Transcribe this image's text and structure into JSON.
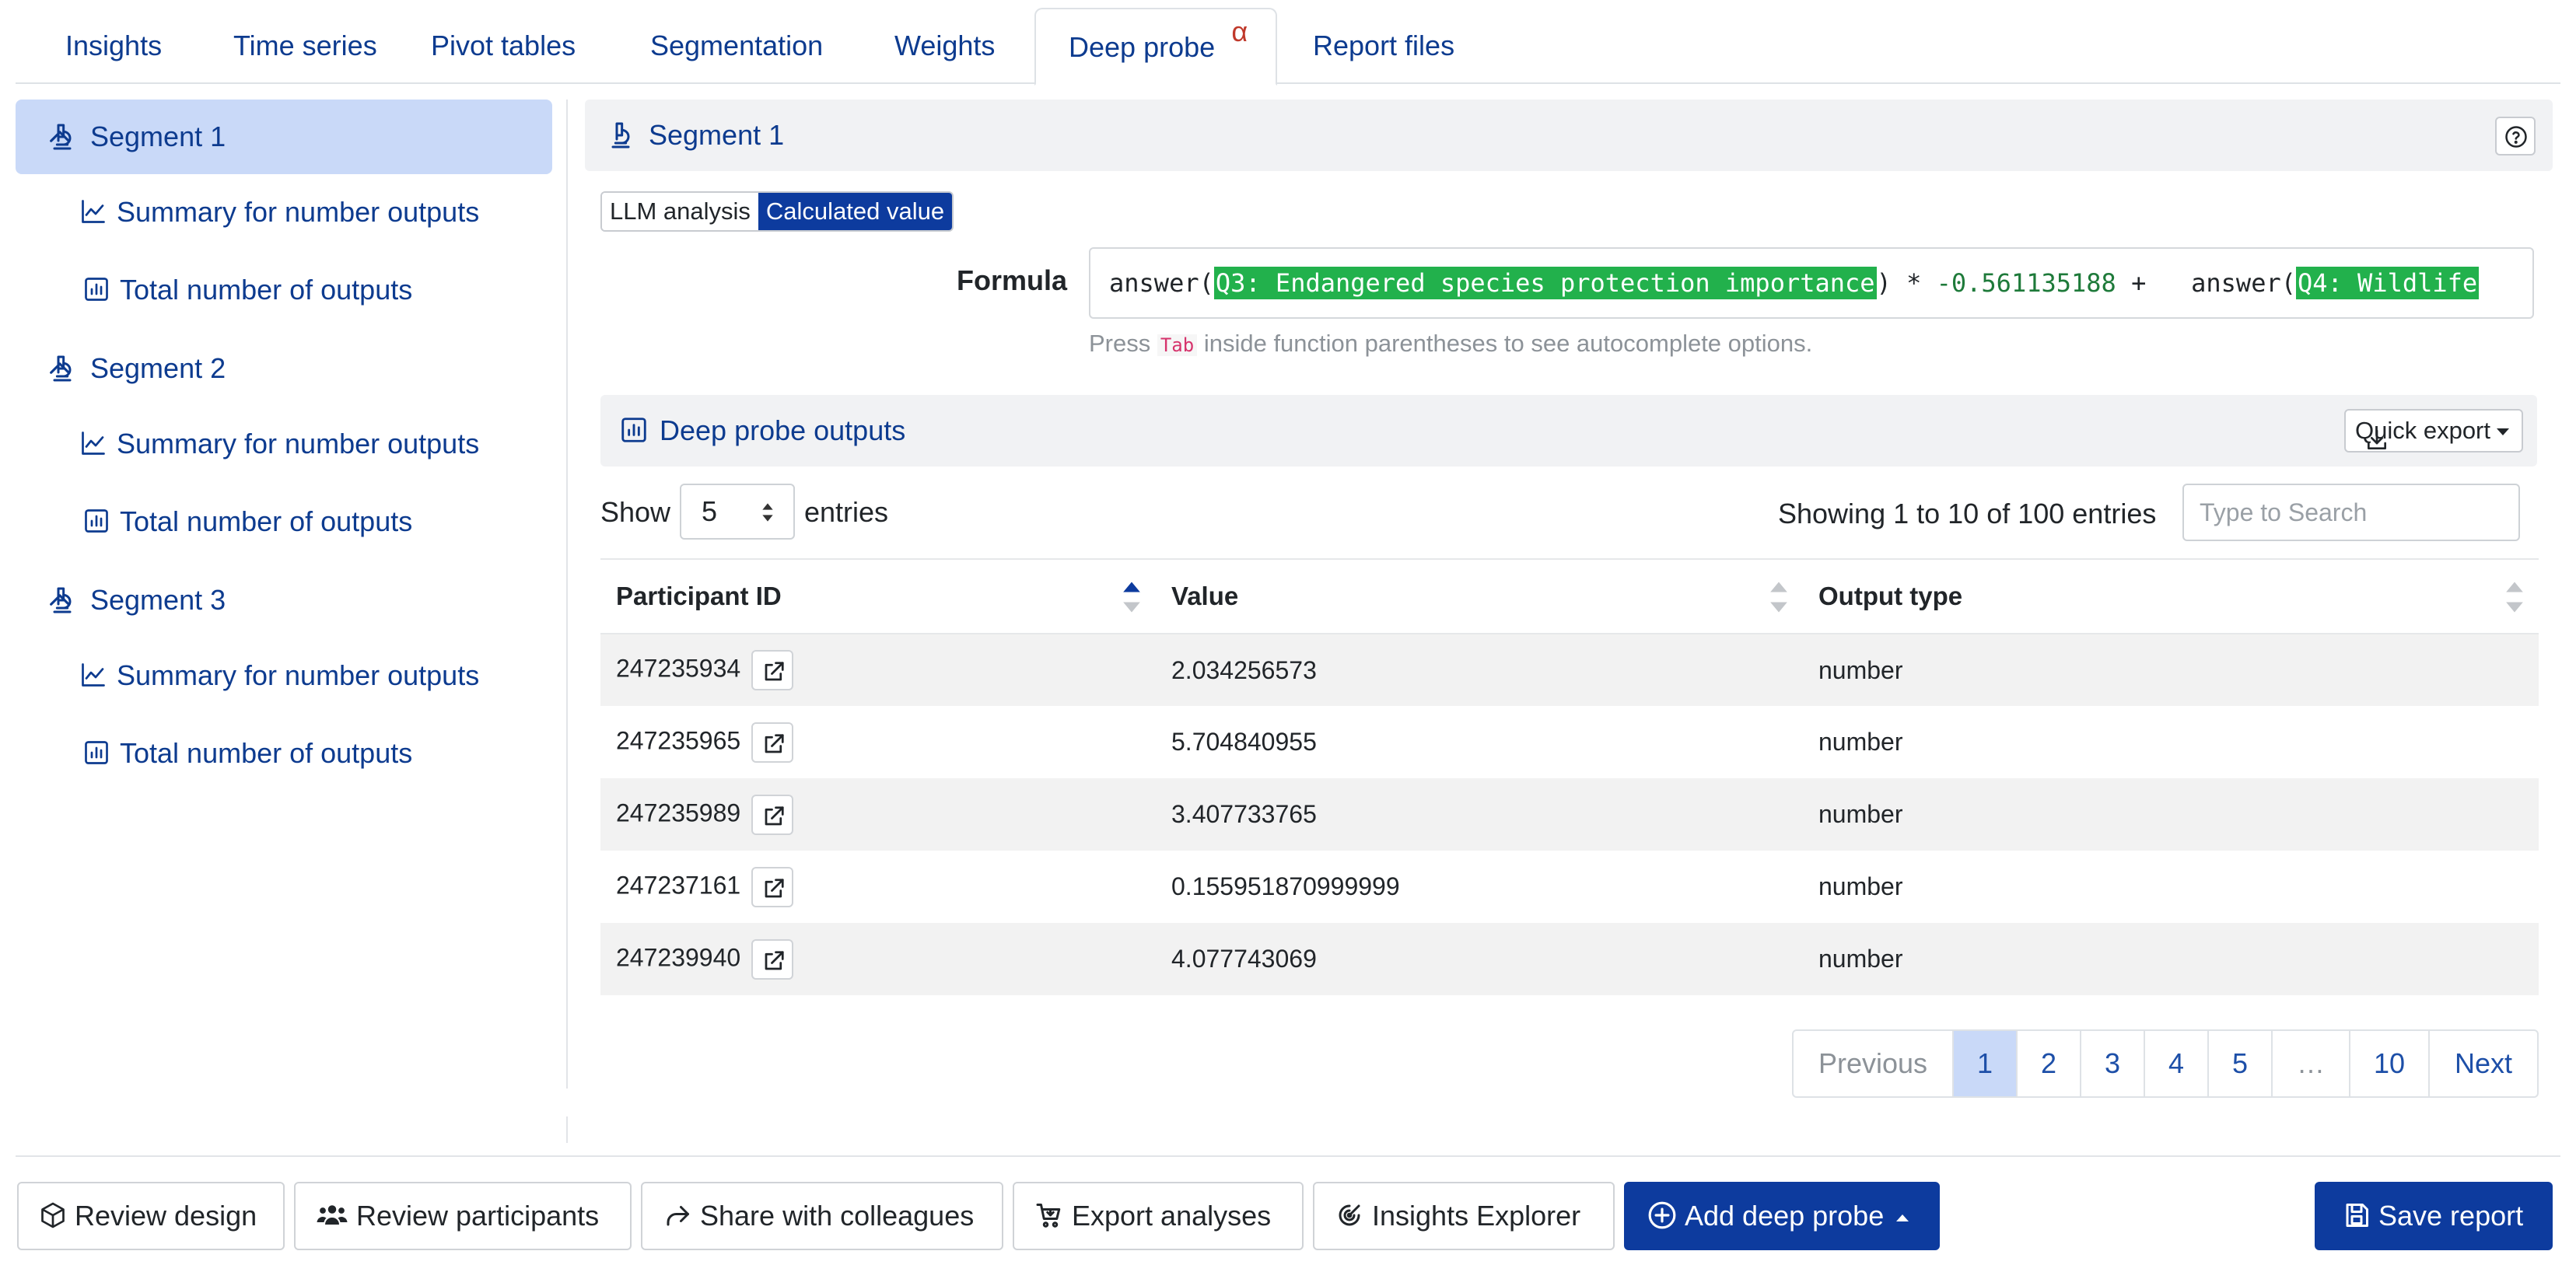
{
  "tabs": [
    {
      "label": "Insights",
      "active": false
    },
    {
      "label": "Time series",
      "active": false
    },
    {
      "label": "Pivot tables",
      "active": false
    },
    {
      "label": "Segmentation",
      "active": false
    },
    {
      "label": "Weights",
      "active": false
    },
    {
      "label": "Deep probe",
      "active": true,
      "badge": "α"
    },
    {
      "label": "Report files",
      "active": false
    }
  ],
  "sidebar": {
    "segments": [
      {
        "label": "Segment 1",
        "items": [
          "Summary for number outputs",
          "Total number of outputs"
        ]
      },
      {
        "label": "Segment 2",
        "items": [
          "Summary for number outputs",
          "Total number of outputs"
        ]
      },
      {
        "label": "Segment 3",
        "items": [
          "Summary for number outputs",
          "Total number of outputs"
        ]
      }
    ]
  },
  "main": {
    "segment_title": "Segment 1",
    "toggle": {
      "llm": "LLM analysis",
      "calc": "Calculated value",
      "selected": "Calculated value"
    },
    "formula": {
      "label": "Formula",
      "fn1": "answer(",
      "token1": "Q3: Endangered species protection importance",
      "close1": ")",
      "op1": " * ",
      "num1": "-0.561135188",
      "op2": " +   ",
      "fn2": "answer(",
      "token2": "Q4: Wildlife"
    },
    "hint": {
      "before": "Press ",
      "key": "Tab",
      "after": " inside function parentheses to see autocomplete options."
    },
    "outputs_title": "Deep probe outputs",
    "quick_export": "Quick export",
    "show_label": "Show",
    "show_value": "5",
    "entries_label": "entries",
    "showing": "Showing 1 to 10 of 100 entries",
    "search_placeholder": "Type to Search",
    "columns": [
      "Participant ID",
      "Value",
      "Output type"
    ],
    "rows": [
      {
        "id": "247235934",
        "value": "2.034256573",
        "type": "number"
      },
      {
        "id": "247235965",
        "value": "5.704840955",
        "type": "number"
      },
      {
        "id": "247235989",
        "value": "3.407733765",
        "type": "number"
      },
      {
        "id": "247237161",
        "value": "0.155951870999999",
        "type": "number"
      },
      {
        "id": "247239940",
        "value": "4.077743069",
        "type": "number"
      }
    ],
    "pagination": [
      "Previous",
      "1",
      "2",
      "3",
      "4",
      "5",
      "…",
      "10",
      "Next"
    ],
    "current_page": "1"
  },
  "footer": {
    "review_design": "Review design",
    "review_participants": "Review participants",
    "share": "Share with colleagues",
    "export": "Export analyses",
    "insights_explorer": "Insights Explorer",
    "add_deep_probe": "Add deep probe",
    "save_report": "Save report"
  },
  "colors": {
    "primary": "#0d3b9e",
    "link": "#0d3b8f",
    "active_bg": "#c9d9f8",
    "token": "#22b14c",
    "alpha": "#c0392b"
  }
}
